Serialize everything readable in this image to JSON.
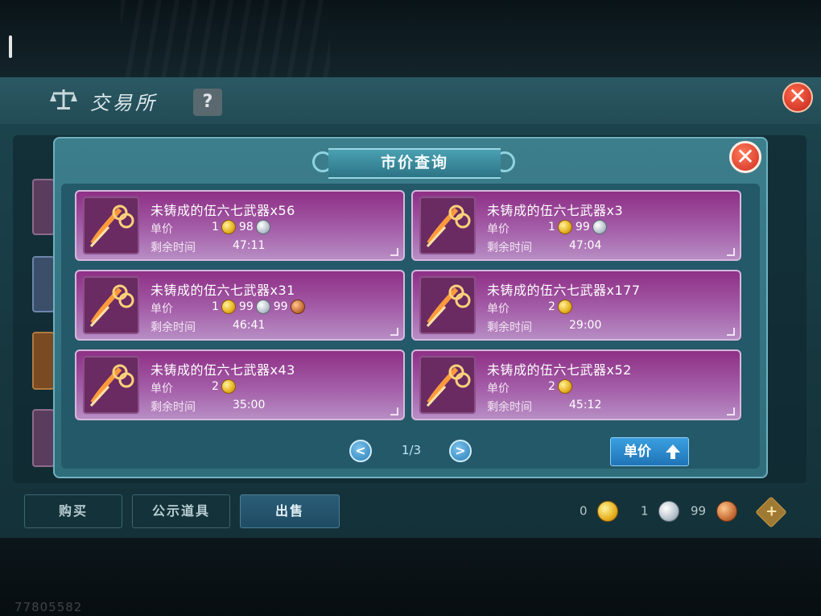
{
  "watermark": "77805582",
  "exchange": {
    "title": "交易所",
    "help_label": "?",
    "close_label": "✕",
    "tabs": [
      {
        "label": "购买",
        "active": false
      },
      {
        "label": "公示道具",
        "active": false
      },
      {
        "label": "出售",
        "active": true
      }
    ],
    "currency": {
      "gold": "0",
      "silver": "1",
      "copper": "99",
      "add_label": "+"
    }
  },
  "modal": {
    "title": "市价查询",
    "close_label": "✕",
    "price_label": "单价",
    "time_label": "剩余时间",
    "listings": [
      {
        "name": "未铸成的伍六七武器x56",
        "gold": "1",
        "silver": "98",
        "copper": "",
        "time": "47:11"
      },
      {
        "name": "未铸成的伍六七武器x3",
        "gold": "1",
        "silver": "99",
        "copper": "",
        "time": "47:04"
      },
      {
        "name": "未铸成的伍六七武器x31",
        "gold": "1",
        "silver": "99",
        "copper": "99",
        "time": "46:41"
      },
      {
        "name": "未铸成的伍六七武器x177",
        "gold": "2",
        "silver": "",
        "copper": "",
        "time": "29:00"
      },
      {
        "name": "未铸成的伍六七武器x43",
        "gold": "2",
        "silver": "",
        "copper": "",
        "time": "35:00"
      },
      {
        "name": "未铸成的伍六七武器x52",
        "gold": "2",
        "silver": "",
        "copper": "",
        "time": "45:12"
      }
    ],
    "pagination": {
      "page": "1/3",
      "prev_label": "<",
      "next_label": ">"
    },
    "sort_label": "单价"
  },
  "colors": {
    "card": "#a45ea8",
    "accent": "#2f6d7b",
    "gold": "#e6b120"
  }
}
